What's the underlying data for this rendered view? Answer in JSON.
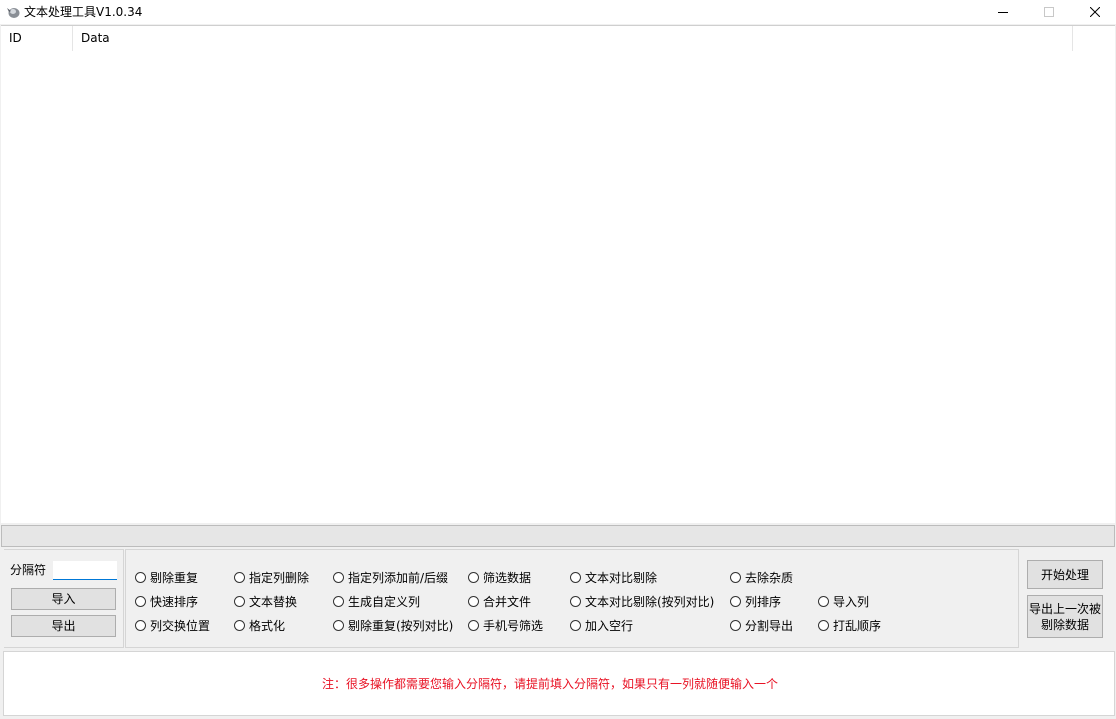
{
  "window": {
    "title": "文本处理工具V1.0.34",
    "minimize_glyph": "—",
    "maximize_glyph": "☐",
    "close_glyph": "✕",
    "icon": "app-icon"
  },
  "listview": {
    "columns": [
      "ID",
      "Data"
    ],
    "rows": []
  },
  "progress": {
    "value": 0
  },
  "left_panel": {
    "separator_label": "分隔符",
    "separator_value": "",
    "import_label": "导入",
    "export_label": "导出"
  },
  "options": [
    "剔除重复",
    "指定列删除",
    "指定列添加前/后缀",
    "筛选数据",
    "文本对比剔除",
    "去除杂质",
    "快速排序",
    "文本替换",
    "生成自定义列",
    "合并文件",
    "文本对比剔除(按列对比)",
    "列排序",
    "导入列",
    "列交换位置",
    "格式化",
    "剔除重复(按列对比)",
    "手机号筛选",
    "加入空行",
    "分割导出",
    "打乱顺序"
  ],
  "right_panel": {
    "start_label": "开始处理",
    "export_last_label": "导出上一次被剔除数据"
  },
  "notice": {
    "text": "注：很多操作都需要您输入分隔符，请提前填入分隔符，如果只有一列就随便输入一个",
    "color": "#e81123"
  },
  "colors": {
    "background": "#f0f0f0",
    "focus_border": "#0078d7"
  }
}
